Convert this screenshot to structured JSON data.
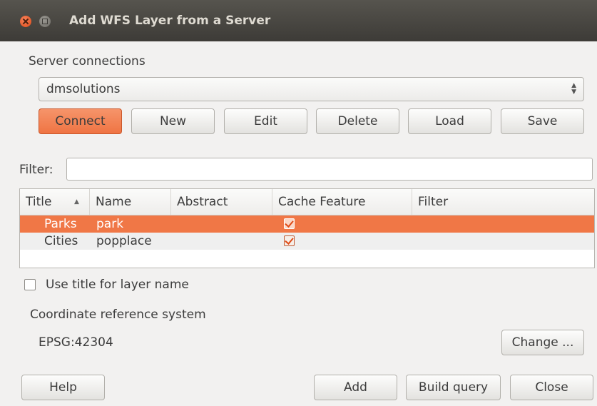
{
  "window": {
    "title": "Add WFS Layer from a Server"
  },
  "server": {
    "label": "Server connections",
    "selected": "dmsolutions"
  },
  "buttons": {
    "connect": "Connect",
    "new": "New",
    "edit": "Edit",
    "delete": "Delete",
    "load": "Load",
    "save": "Save"
  },
  "filter": {
    "label": "Filter:",
    "value": ""
  },
  "table": {
    "columns": [
      "Title",
      "Name",
      "Abstract",
      "Cache Feature",
      "Filter"
    ],
    "rows": [
      {
        "title": "Parks",
        "name": "park",
        "abstract": "",
        "cache": true,
        "filter": "",
        "selected": true
      },
      {
        "title": "Cities",
        "name": "popplace",
        "abstract": "",
        "cache": true,
        "filter": "",
        "selected": false
      }
    ]
  },
  "use_title": {
    "label": "Use title for layer name",
    "checked": false
  },
  "crs": {
    "label": "Coordinate reference system",
    "value": "EPSG:42304",
    "change": "Change ..."
  },
  "footer": {
    "help": "Help",
    "add": "Add",
    "build_query": "Build query",
    "close": "Close"
  },
  "colors": {
    "accent": "#f07746",
    "titlebar": "#3d3b37",
    "background": "#f2f1f0"
  }
}
